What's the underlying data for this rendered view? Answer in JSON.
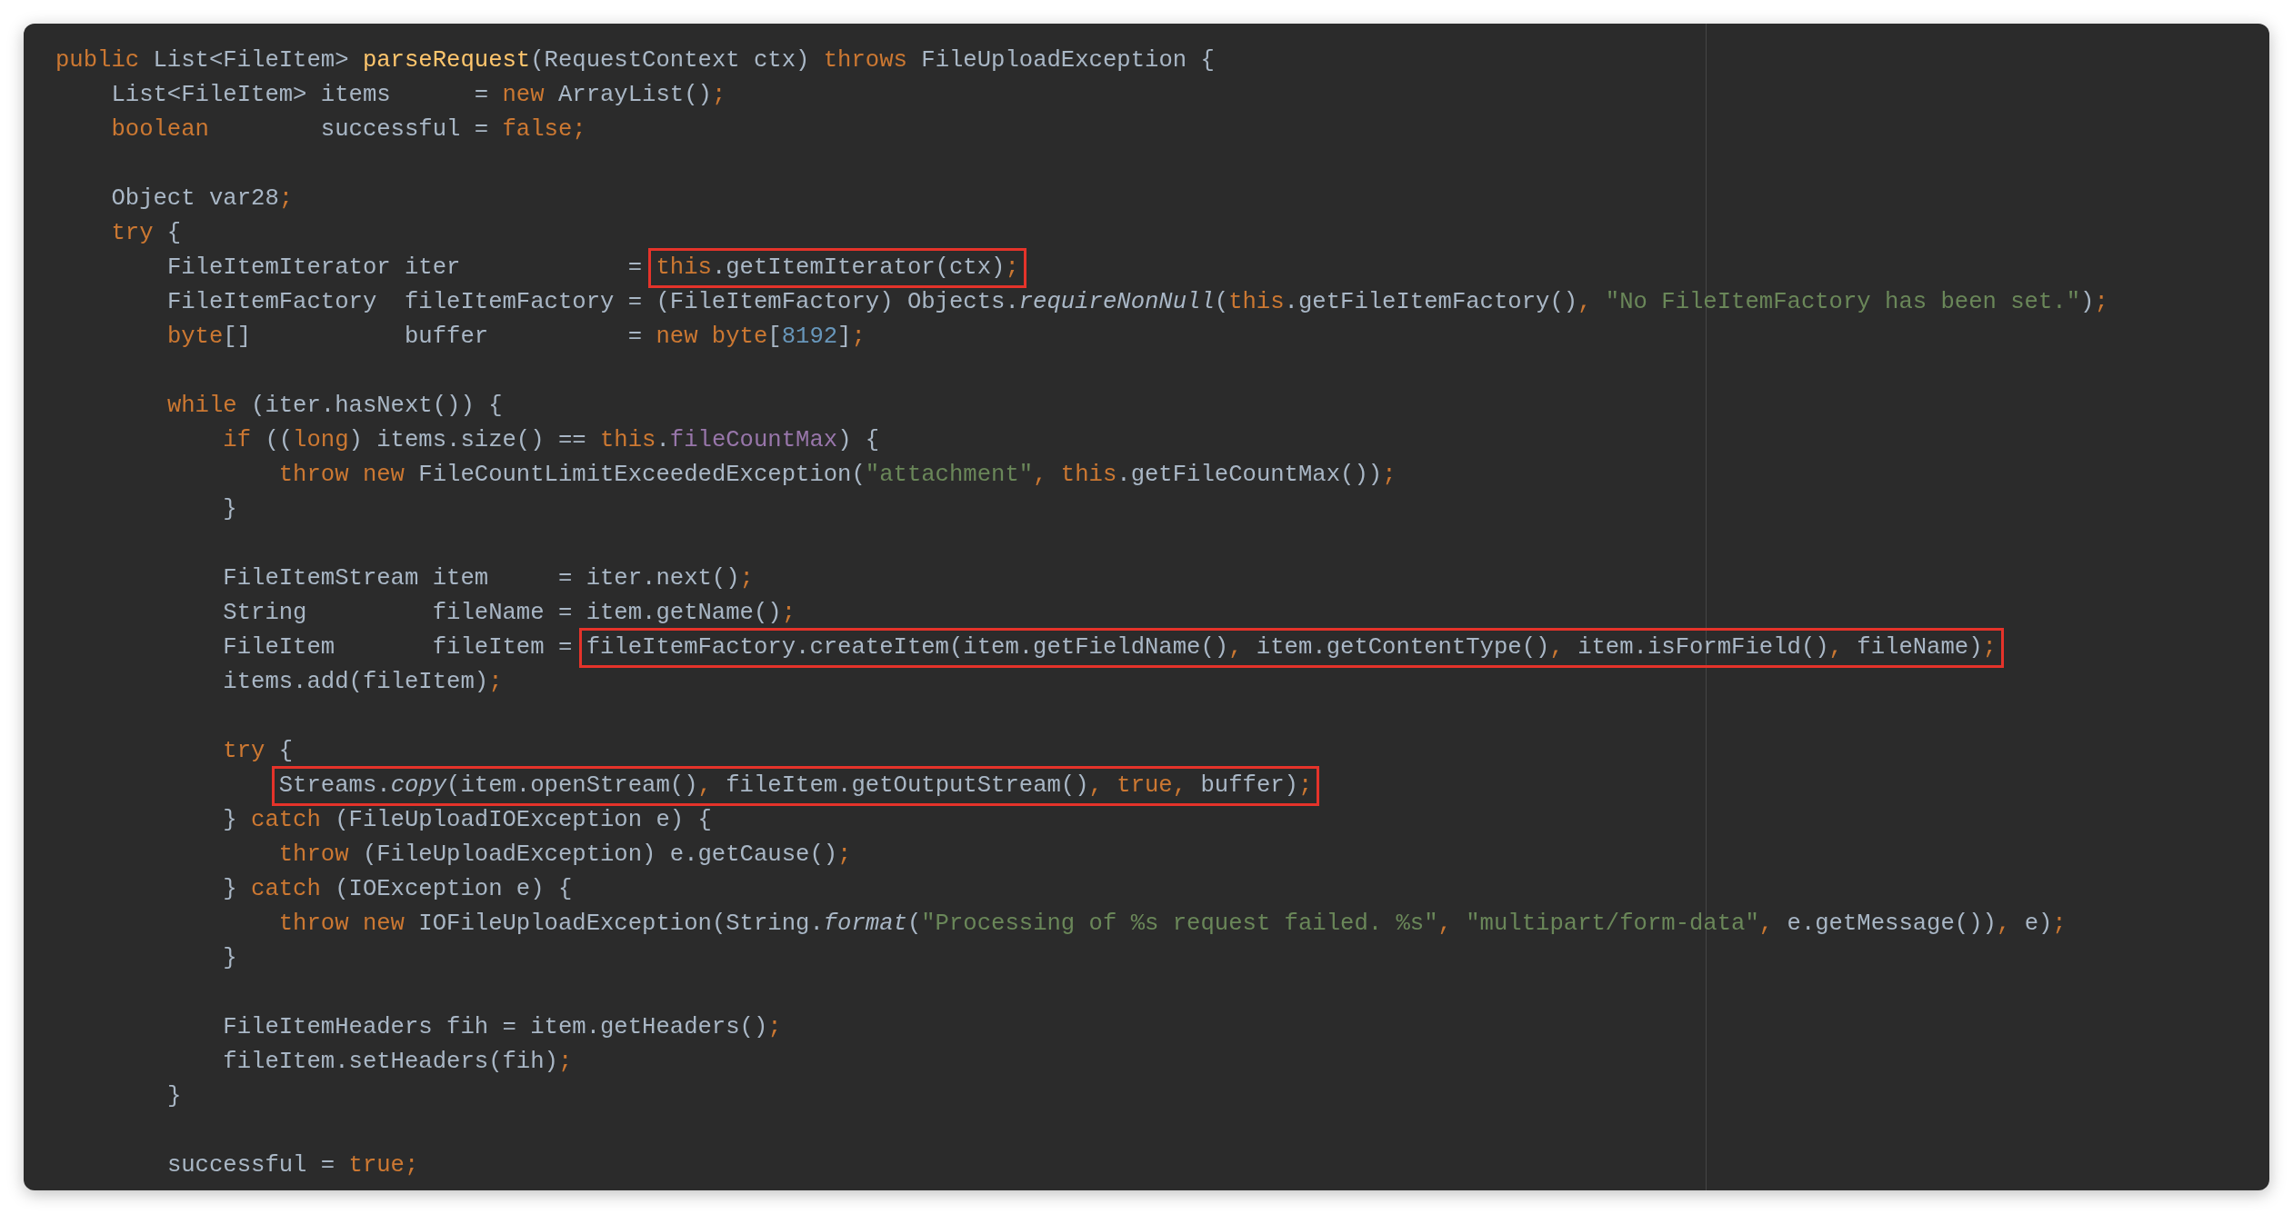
{
  "editor": {
    "lines": [
      {
        "kind": "code",
        "segments": [
          {
            "kind": "text",
            "tokens": [
              {
                "kind": "keyword",
                "text": "public"
              },
              {
                "kind": "plain",
                "text": " List<FileItem> "
              },
              {
                "kind": "method",
                "text": "parseRequest"
              },
              {
                "kind": "plain",
                "text": "(RequestContext ctx) "
              },
              {
                "kind": "keyword",
                "text": "throws"
              },
              {
                "kind": "plain",
                "text": " FileUploadException {"
              }
            ]
          }
        ]
      },
      {
        "kind": "code",
        "segments": [
          {
            "kind": "text",
            "tokens": [
              {
                "kind": "plain",
                "text": "    List<FileItem> items      = "
              },
              {
                "kind": "keyword",
                "text": "new"
              },
              {
                "kind": "plain",
                "text": " ArrayList()"
              },
              {
                "kind": "keyword",
                "text": ";"
              }
            ]
          }
        ]
      },
      {
        "kind": "code",
        "segments": [
          {
            "kind": "text",
            "tokens": [
              {
                "kind": "keyword",
                "text": "    boolean"
              },
              {
                "kind": "plain",
                "text": "        successful = "
              },
              {
                "kind": "keyword",
                "text": "false;"
              }
            ]
          }
        ]
      },
      {
        "kind": "blank"
      },
      {
        "kind": "code",
        "segments": [
          {
            "kind": "text",
            "tokens": [
              {
                "kind": "plain",
                "text": "    Object var28"
              },
              {
                "kind": "keyword",
                "text": ";"
              }
            ]
          }
        ]
      },
      {
        "kind": "code",
        "segments": [
          {
            "kind": "text",
            "tokens": [
              {
                "kind": "keyword",
                "text": "    try"
              },
              {
                "kind": "plain",
                "text": " {"
              }
            ]
          }
        ]
      },
      {
        "kind": "code",
        "segments": [
          {
            "kind": "text",
            "tokens": [
              {
                "kind": "plain",
                "text": "        FileItemIterator iter            = "
              }
            ]
          },
          {
            "kind": "box",
            "tokens": [
              {
                "kind": "keyword",
                "text": "this"
              },
              {
                "kind": "plain",
                "text": ".getItemIterator(ctx)"
              },
              {
                "kind": "keyword",
                "text": ";"
              }
            ]
          }
        ]
      },
      {
        "kind": "code",
        "segments": [
          {
            "kind": "text",
            "tokens": [
              {
                "kind": "plain",
                "text": "        FileItemFactory  fileItemFactory = (FileItemFactory) Objects."
              },
              {
                "kind": "static",
                "text": "requireNonNull"
              },
              {
                "kind": "plain",
                "text": "("
              },
              {
                "kind": "keyword",
                "text": "this"
              },
              {
                "kind": "plain",
                "text": ".getFileItemFactory()"
              },
              {
                "kind": "keyword",
                "text": ","
              },
              {
                "kind": "string",
                "text": " \"No FileItemFactory has been set.\""
              },
              {
                "kind": "plain",
                "text": ")"
              },
              {
                "kind": "keyword",
                "text": ";"
              }
            ]
          }
        ]
      },
      {
        "kind": "code",
        "segments": [
          {
            "kind": "text",
            "tokens": [
              {
                "kind": "keyword",
                "text": "        byte"
              },
              {
                "kind": "plain",
                "text": "[]           buffer          = "
              },
              {
                "kind": "keyword",
                "text": "new byte"
              },
              {
                "kind": "plain",
                "text": "["
              },
              {
                "kind": "number",
                "text": "8192"
              },
              {
                "kind": "plain",
                "text": "]"
              },
              {
                "kind": "keyword",
                "text": ";"
              }
            ]
          }
        ]
      },
      {
        "kind": "blank"
      },
      {
        "kind": "code",
        "segments": [
          {
            "kind": "text",
            "tokens": [
              {
                "kind": "keyword",
                "text": "        while"
              },
              {
                "kind": "plain",
                "text": " (iter.hasNext()) {"
              }
            ]
          }
        ]
      },
      {
        "kind": "code",
        "segments": [
          {
            "kind": "text",
            "tokens": [
              {
                "kind": "keyword",
                "text": "            if"
              },
              {
                "kind": "plain",
                "text": " (("
              },
              {
                "kind": "keyword",
                "text": "long"
              },
              {
                "kind": "plain",
                "text": ") items.size() == "
              },
              {
                "kind": "keyword",
                "text": "this"
              },
              {
                "kind": "plain",
                "text": "."
              },
              {
                "kind": "field",
                "text": "fileCountMax"
              },
              {
                "kind": "plain",
                "text": ") {"
              }
            ]
          }
        ]
      },
      {
        "kind": "code",
        "segments": [
          {
            "kind": "text",
            "tokens": [
              {
                "kind": "keyword",
                "text": "                throw new"
              },
              {
                "kind": "plain",
                "text": " FileCountLimitExceededException("
              },
              {
                "kind": "string",
                "text": "\"attachment\""
              },
              {
                "kind": "keyword",
                "text": ", this"
              },
              {
                "kind": "plain",
                "text": ".getFileCountMax())"
              },
              {
                "kind": "keyword",
                "text": ";"
              }
            ]
          }
        ]
      },
      {
        "kind": "code",
        "segments": [
          {
            "kind": "text",
            "tokens": [
              {
                "kind": "plain",
                "text": "            }"
              }
            ]
          }
        ]
      },
      {
        "kind": "blank"
      },
      {
        "kind": "code",
        "segments": [
          {
            "kind": "text",
            "tokens": [
              {
                "kind": "plain",
                "text": "            FileItemStream item     = iter.next()"
              },
              {
                "kind": "keyword",
                "text": ";"
              }
            ]
          }
        ]
      },
      {
        "kind": "code",
        "segments": [
          {
            "kind": "text",
            "tokens": [
              {
                "kind": "plain",
                "text": "            String         fileName = item.getName()"
              },
              {
                "kind": "keyword",
                "text": ";"
              }
            ]
          }
        ]
      },
      {
        "kind": "code",
        "segments": [
          {
            "kind": "text",
            "tokens": [
              {
                "kind": "plain",
                "text": "            FileItem       fileItem = "
              }
            ]
          },
          {
            "kind": "box",
            "tokens": [
              {
                "kind": "plain",
                "text": "fileItemFactory.createItem(item.getFieldName()"
              },
              {
                "kind": "keyword",
                "text": ","
              },
              {
                "kind": "plain",
                "text": " item.getContentType()"
              },
              {
                "kind": "keyword",
                "text": ","
              },
              {
                "kind": "plain",
                "text": " item.isFormField()"
              },
              {
                "kind": "keyword",
                "text": ","
              },
              {
                "kind": "plain",
                "text": " fileName)"
              },
              {
                "kind": "keyword",
                "text": ";"
              }
            ]
          }
        ]
      },
      {
        "kind": "code",
        "segments": [
          {
            "kind": "text",
            "tokens": [
              {
                "kind": "plain",
                "text": "            items.add(fileItem)"
              },
              {
                "kind": "keyword",
                "text": ";"
              }
            ]
          }
        ]
      },
      {
        "kind": "blank"
      },
      {
        "kind": "code",
        "segments": [
          {
            "kind": "text",
            "tokens": [
              {
                "kind": "keyword",
                "text": "            try"
              },
              {
                "kind": "plain",
                "text": " {"
              }
            ]
          }
        ]
      },
      {
        "kind": "code",
        "segments": [
          {
            "kind": "box",
            "tokens": [
              {
                "kind": "plain",
                "text": "                Streams."
              },
              {
                "kind": "static",
                "text": "copy"
              },
              {
                "kind": "plain",
                "text": "(item.openStream()"
              },
              {
                "kind": "keyword",
                "text": ","
              },
              {
                "kind": "plain",
                "text": " fileItem.getOutputStream()"
              },
              {
                "kind": "keyword",
                "text": ", true,"
              },
              {
                "kind": "plain",
                "text": " buffer)"
              },
              {
                "kind": "keyword",
                "text": ";"
              }
            ]
          }
        ]
      },
      {
        "kind": "code",
        "segments": [
          {
            "kind": "text",
            "tokens": [
              {
                "kind": "plain",
                "text": "            } "
              },
              {
                "kind": "keyword",
                "text": "catch"
              },
              {
                "kind": "plain",
                "text": " (FileUploadIOException e) {"
              }
            ]
          }
        ]
      },
      {
        "kind": "code",
        "segments": [
          {
            "kind": "text",
            "tokens": [
              {
                "kind": "keyword",
                "text": "                throw"
              },
              {
                "kind": "plain",
                "text": " (FileUploadException) e.getCause()"
              },
              {
                "kind": "keyword",
                "text": ";"
              }
            ]
          }
        ]
      },
      {
        "kind": "code",
        "segments": [
          {
            "kind": "text",
            "tokens": [
              {
                "kind": "plain",
                "text": "            } "
              },
              {
                "kind": "keyword",
                "text": "catch"
              },
              {
                "kind": "plain",
                "text": " (IOException e) {"
              }
            ]
          }
        ]
      },
      {
        "kind": "code",
        "segments": [
          {
            "kind": "text",
            "tokens": [
              {
                "kind": "keyword",
                "text": "                throw new"
              },
              {
                "kind": "plain",
                "text": " IOFileUploadException(String."
              },
              {
                "kind": "static",
                "text": "format"
              },
              {
                "kind": "plain",
                "text": "("
              },
              {
                "kind": "string",
                "text": "\"Processing of %s request failed. %s\""
              },
              {
                "kind": "keyword",
                "text": ","
              },
              {
                "kind": "string",
                "text": " \"multipart/form-data\""
              },
              {
                "kind": "keyword",
                "text": ","
              },
              {
                "kind": "plain",
                "text": " e.getMessage())"
              },
              {
                "kind": "keyword",
                "text": ","
              },
              {
                "kind": "plain",
                "text": " e)"
              },
              {
                "kind": "keyword",
                "text": ";"
              }
            ]
          }
        ]
      },
      {
        "kind": "code",
        "segments": [
          {
            "kind": "text",
            "tokens": [
              {
                "kind": "plain",
                "text": "            }"
              }
            ]
          }
        ]
      },
      {
        "kind": "blank"
      },
      {
        "kind": "code",
        "segments": [
          {
            "kind": "text",
            "tokens": [
              {
                "kind": "plain",
                "text": "            FileItemHeaders fih = item.getHeaders()"
              },
              {
                "kind": "keyword",
                "text": ";"
              }
            ]
          }
        ]
      },
      {
        "kind": "code",
        "segments": [
          {
            "kind": "text",
            "tokens": [
              {
                "kind": "plain",
                "text": "            fileItem.setHeaders(fih)"
              },
              {
                "kind": "keyword",
                "text": ";"
              }
            ]
          }
        ]
      },
      {
        "kind": "code",
        "segments": [
          {
            "kind": "text",
            "tokens": [
              {
                "kind": "plain",
                "text": "        }"
              }
            ]
          }
        ]
      },
      {
        "kind": "blank"
      },
      {
        "kind": "code",
        "segments": [
          {
            "kind": "text",
            "tokens": [
              {
                "kind": "plain",
                "text": "        successful = "
              },
              {
                "kind": "keyword",
                "text": "true;"
              }
            ]
          }
        ]
      }
    ]
  }
}
